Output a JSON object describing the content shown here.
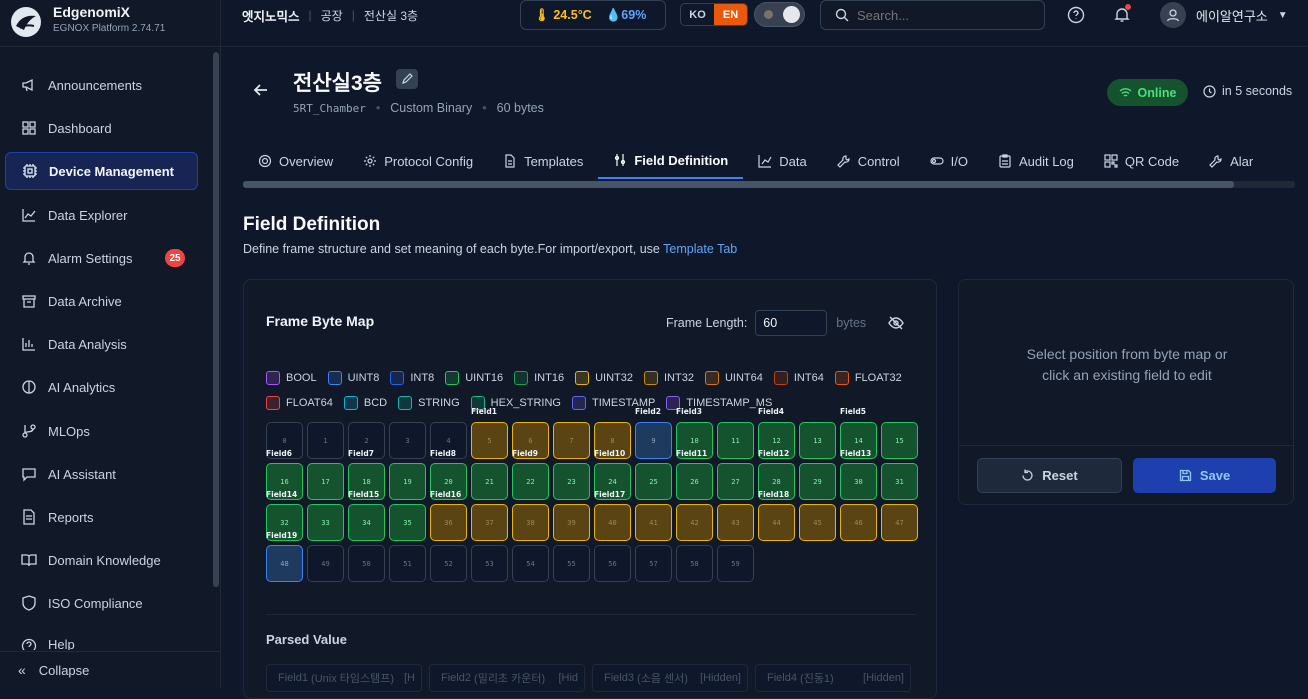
{
  "brand": {
    "name": "EdgenomiX",
    "version": "EGNOX Platform 2.74.71"
  },
  "sidebar": {
    "items": [
      {
        "label": "Announcements",
        "icon": "megaphone-icon"
      },
      {
        "label": "Dashboard",
        "icon": "dashboard-icon"
      },
      {
        "label": "Device Management",
        "icon": "chip-icon",
        "active": true
      },
      {
        "label": "Data Explorer",
        "icon": "chart-line-icon"
      },
      {
        "label": "Alarm Settings",
        "icon": "bell-icon",
        "badge": "25"
      },
      {
        "label": "Data Archive",
        "icon": "archive-icon"
      },
      {
        "label": "Data Analysis",
        "icon": "bar-chart-icon"
      },
      {
        "label": "AI Analytics",
        "icon": "brain-icon"
      },
      {
        "label": "MLOps",
        "icon": "git-icon"
      },
      {
        "label": "AI Assistant",
        "icon": "chat-icon"
      },
      {
        "label": "Reports",
        "icon": "report-icon"
      },
      {
        "label": "Domain Knowledge",
        "icon": "book-icon"
      },
      {
        "label": "ISO Compliance",
        "icon": "shield-icon"
      },
      {
        "label": "Help",
        "icon": "help-icon"
      }
    ],
    "collapse_label": "Collapse"
  },
  "topbar": {
    "breadcrumb": [
      "엣지노믹스",
      "공장",
      "전산실 3층"
    ],
    "temperature": "24.5°C",
    "humidity": "69%",
    "lang": {
      "ko": "KO",
      "en": "EN",
      "active": "EN"
    },
    "search_placeholder": "Search...",
    "user_name": "에이알연구소"
  },
  "device": {
    "title": "전산실3층",
    "id": "5RT_Chamber",
    "protocol": "Custom Binary",
    "size": "60 bytes",
    "status": "Online",
    "refresh": "in 5 seconds"
  },
  "tabs": [
    {
      "label": "Overview",
      "icon": "gear-icon"
    },
    {
      "label": "Protocol Config",
      "icon": "cog-icon"
    },
    {
      "label": "Templates",
      "icon": "file-icon"
    },
    {
      "label": "Field Definition",
      "icon": "sliders-icon",
      "active": true
    },
    {
      "label": "Data",
      "icon": "chart-icon"
    },
    {
      "label": "Control",
      "icon": "wrench-icon"
    },
    {
      "label": "I/O",
      "icon": "toggle-icon"
    },
    {
      "label": "Audit Log",
      "icon": "clipboard-icon"
    },
    {
      "label": "QR Code",
      "icon": "qr-icon"
    },
    {
      "label": "Alar",
      "icon": "wrench-icon"
    }
  ],
  "section": {
    "title": "Field Definition",
    "desc": "Define frame structure and set meaning of each byte.For import/export, use ",
    "link": "Template Tab"
  },
  "bytemap": {
    "title": "Frame Byte Map",
    "frame_length_label": "Frame Length:",
    "frame_length": "60",
    "unit": "bytes",
    "legend": [
      {
        "label": "BOOL",
        "color": "#a855f7"
      },
      {
        "label": "UINT8",
        "color": "#3b82f6"
      },
      {
        "label": "INT8",
        "color": "#2563eb"
      },
      {
        "label": "UINT16",
        "color": "#22c55e"
      },
      {
        "label": "INT16",
        "color": "#16a34a"
      },
      {
        "label": "UINT32",
        "color": "#eab308"
      },
      {
        "label": "INT32",
        "color": "#ca8a04"
      },
      {
        "label": "UINT64",
        "color": "#d97706"
      },
      {
        "label": "INT64",
        "color": "#c2410c"
      },
      {
        "label": "FLOAT32",
        "color": "#ea580c"
      },
      {
        "label": "FLOAT64",
        "color": "#ef4444"
      },
      {
        "label": "BCD",
        "color": "#06b6d4"
      },
      {
        "label": "STRING",
        "color": "#14b8a6"
      },
      {
        "label": "HEX_STRING",
        "color": "#10b981"
      },
      {
        "label": "TIMESTAMP",
        "color": "#6366f1"
      },
      {
        "label": "TIMESTAMP_MS",
        "color": "#8b5cf6"
      }
    ],
    "field_labels": [
      "Field1",
      "Field2",
      "Field3",
      "Field4",
      "Field5",
      "Field6",
      "Field7",
      "Field8",
      "Field9",
      "Field10",
      "Field11",
      "Field12",
      "Field13",
      "Field14",
      "Field15",
      "Field16",
      "Field17",
      "Field18",
      "Field19"
    ],
    "parsed_label": "Parsed Value",
    "parsed": [
      {
        "name": "Field1",
        "detail": "(Unix 타임스탬프)",
        "state": "[H"
      },
      {
        "name": "Field2",
        "detail": "(밀리초 카운터)",
        "state": "[Hid"
      },
      {
        "name": "Field3",
        "detail": "(소음 센서)",
        "state": "[Hidden]"
      },
      {
        "name": "Field4",
        "detail": "(진동1)",
        "state": "[Hidden]"
      }
    ]
  },
  "editor": {
    "message_line1": "Select position from byte map or",
    "message_line2": "click an existing field to edit",
    "reset": "Reset",
    "save": "Save"
  }
}
